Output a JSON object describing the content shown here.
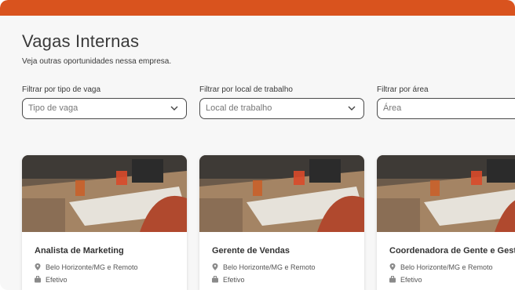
{
  "header": {
    "title": "Vagas Internas",
    "subtitle": "Veja outras oportunidades nessa empresa."
  },
  "filters": [
    {
      "label": "Filtrar por tipo de vaga",
      "placeholder": "Tipo de vaga"
    },
    {
      "label": "Filtrar por local de trabalho",
      "placeholder": "Local de trabalho"
    },
    {
      "label": "Filtrar por área",
      "placeholder": "Área"
    }
  ],
  "jobs": [
    {
      "title": "Analista de Marketing",
      "location": "Belo Horizonte/MG e Remoto",
      "type": "Efetivo"
    },
    {
      "title": "Gerente de Vendas",
      "location": "Belo Horizonte/MG e Remoto",
      "type": "Efetivo"
    },
    {
      "title": "Coordenadora de Gente e Gestão",
      "location": "Belo Horizonte/MG e Remoto",
      "type": "Efetivo"
    }
  ],
  "colors": {
    "brand": "#d9531e",
    "background": "#f7f7f7",
    "text": "#3a3a3a"
  },
  "icons": [
    "chevron-down-icon",
    "location-pin-icon",
    "briefcase-icon"
  ]
}
